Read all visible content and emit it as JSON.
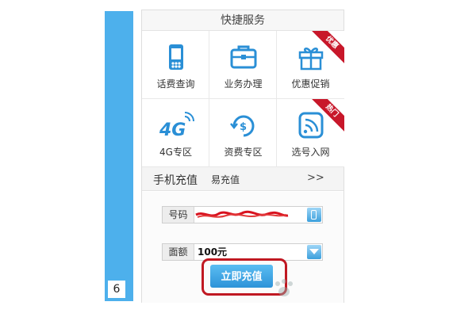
{
  "sidebar": {
    "page_number": "6"
  },
  "panel": {
    "title": "快捷服务",
    "grid": [
      {
        "label": "话费查询",
        "icon": "phone-icon"
      },
      {
        "label": "业务办理",
        "icon": "briefcase-icon"
      },
      {
        "label": "优惠促销",
        "icon": "gift-icon",
        "badge": "优惠"
      },
      {
        "label": "4G专区",
        "icon": "4g-icon"
      },
      {
        "label": "资费专区",
        "icon": "refresh-dollar-icon"
      },
      {
        "label": "选号入网",
        "icon": "wifi-phone-icon",
        "badge": "热门"
      }
    ],
    "tabs": {
      "active": "手机充值",
      "second": "易充值",
      "more": ">>"
    },
    "form": {
      "phone_label": "号码",
      "amount_label": "面额",
      "amount_value": "100元"
    },
    "submit_label": "立即充值"
  },
  "colors": {
    "accent": "#4db0ec",
    "ribbon": "#c8172a",
    "icon_blue": "#2a8fd6"
  }
}
